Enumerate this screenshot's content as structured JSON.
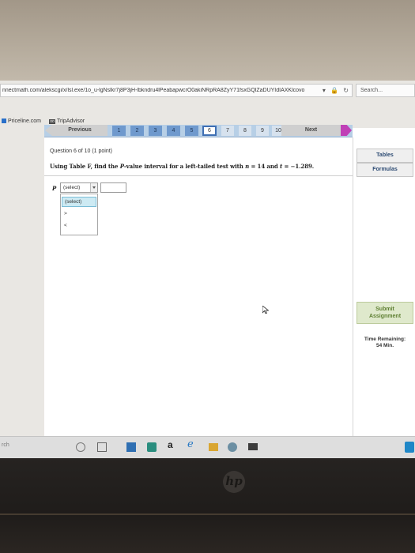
{
  "browser": {
    "url": "nnectmath.com/alekscgi/x/lsl.exe/1o_u-lgNslkr7j8P3jH-lbkndru4lPeabapwcrO0akiNRpRA8ZyY71fsxGQlZaDUYIdIAXKlcovo",
    "search_placeholder": "Search...",
    "favorites": [
      {
        "label": "Priceline.com",
        "icon": "priceline-icon"
      },
      {
        "label": "TripAdvisor",
        "icon": "tripadvisor-icon"
      }
    ]
  },
  "nav": {
    "previous_label": "Previous",
    "next_label": "Next",
    "questions": [
      "1",
      "2",
      "3",
      "4",
      "5",
      "6",
      "7",
      "8",
      "9",
      "10"
    ],
    "current": "6"
  },
  "question": {
    "header": "Question 6 of 10 (1 point)",
    "text_parts": {
      "prefix": "Using Table F, find the ",
      "p_var": "P",
      "mid1": "-value interval for a left-tailed test with ",
      "n_var": "n",
      "mid2": " = 14 and ",
      "t_var": "t",
      "mid3": " = −1.289."
    }
  },
  "answer": {
    "p_label": "P",
    "select_value": "(select)",
    "options": [
      "(select)",
      ">",
      "<"
    ],
    "input_value": ""
  },
  "side": {
    "tables_label": "Tables",
    "formulas_label": "Formulas",
    "submit_label_1": "Submit",
    "submit_label_2": "Assignment",
    "time_label": "Time Remaining:",
    "time_value": "54 Min."
  },
  "taskbar": {
    "search_text": "rch",
    "icons": [
      "cortana-icon",
      "task-view-icon",
      "store-icon",
      "photos-icon",
      "amazon-icon",
      "edge-icon",
      "folder-icon",
      "media-icon",
      "mail-icon"
    ]
  },
  "colors": {
    "nav_active": "#6f99cd",
    "next_arrow": "#c040b6",
    "submit_text": "#5e7f32",
    "link_text": "#2d4b73"
  }
}
